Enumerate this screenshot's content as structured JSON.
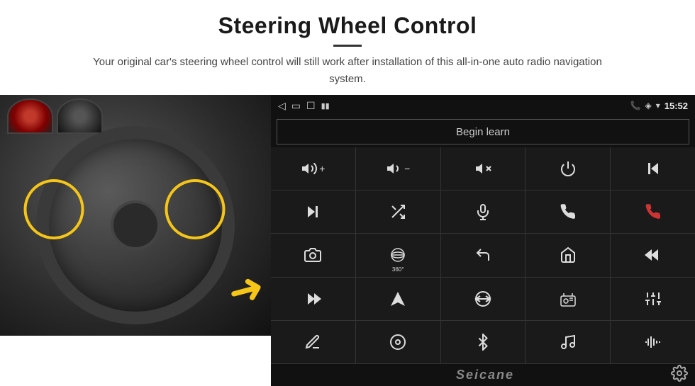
{
  "header": {
    "title": "Steering Wheel Control",
    "subtitle": "Your original car's steering wheel control will still work after installation of this all-in-one auto radio navigation system."
  },
  "status_bar": {
    "time": "15:52",
    "back_icon": "◁",
    "home_icon": "▭",
    "recent_icon": "☐",
    "phone_icon": "📞",
    "location_icon": "◈",
    "wifi_icon": "▾",
    "battery_icon": "▮"
  },
  "begin_learn": {
    "label": "Begin learn"
  },
  "controls": [
    {
      "id": "vol-up",
      "icon": "vol_up",
      "symbol": "🔊+"
    },
    {
      "id": "vol-down",
      "icon": "vol_down",
      "symbol": "🔊−"
    },
    {
      "id": "vol-mute",
      "icon": "vol_mute",
      "symbol": "🔇"
    },
    {
      "id": "power",
      "icon": "power",
      "symbol": "⏻"
    },
    {
      "id": "prev-track",
      "icon": "prev-track",
      "symbol": "⏮"
    },
    {
      "id": "next",
      "icon": "next",
      "symbol": "⏭"
    },
    {
      "id": "shuffle",
      "icon": "shuffle",
      "symbol": "⇄"
    },
    {
      "id": "mic",
      "icon": "mic",
      "symbol": "🎤"
    },
    {
      "id": "phone",
      "icon": "phone",
      "symbol": "📞"
    },
    {
      "id": "hang-up",
      "icon": "hang-up",
      "symbol": "↩"
    },
    {
      "id": "camera",
      "icon": "camera",
      "symbol": "📷"
    },
    {
      "id": "view360",
      "icon": "view360",
      "symbol": "⊙"
    },
    {
      "id": "back",
      "icon": "back",
      "symbol": "↩"
    },
    {
      "id": "home",
      "icon": "home",
      "symbol": "⌂"
    },
    {
      "id": "skip-back",
      "icon": "skip-back",
      "symbol": "⏮"
    },
    {
      "id": "fast-forward",
      "icon": "fast-forward",
      "symbol": "⏭"
    },
    {
      "id": "navigate",
      "icon": "navigate",
      "symbol": "▲"
    },
    {
      "id": "switch",
      "icon": "switch",
      "symbol": "⇄"
    },
    {
      "id": "radio",
      "icon": "radio",
      "symbol": "📻"
    },
    {
      "id": "equalizer",
      "icon": "equalizer",
      "symbol": "⚙"
    },
    {
      "id": "edit",
      "icon": "edit",
      "symbol": "✏"
    },
    {
      "id": "settings-circle",
      "icon": "settings-circle",
      "symbol": "⊙"
    },
    {
      "id": "bluetooth",
      "icon": "bluetooth",
      "symbol": "⚡"
    },
    {
      "id": "music",
      "icon": "music",
      "symbol": "🎵"
    },
    {
      "id": "wave",
      "icon": "wave",
      "symbol": "📶"
    }
  ],
  "brand": {
    "name": "Seicane"
  }
}
